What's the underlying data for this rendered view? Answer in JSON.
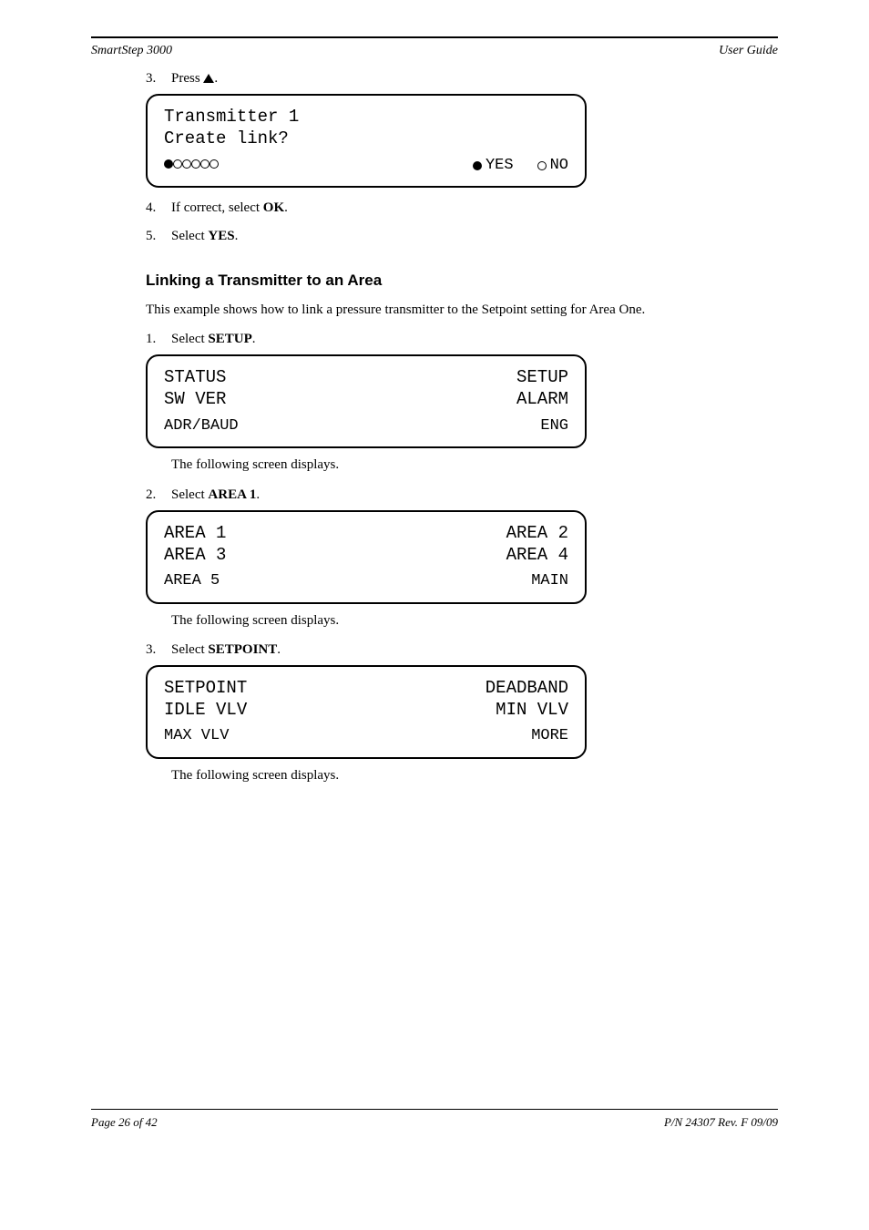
{
  "header": {
    "left": "SmartStep 3000",
    "right": "User Guide"
  },
  "steps": {
    "s3": {
      "num": "3.",
      "text_before": "Press ",
      "text_after": "."
    },
    "s4": {
      "num": "4.",
      "text_before": "If correct, select ",
      "label": "OK",
      "text_after": "."
    },
    "s5": {
      "num": "5.",
      "text_before": "Select ",
      "label": "YES",
      "text_after": "."
    }
  },
  "triangle_note": "▲",
  "section2": {
    "heading": "Linking a Transmitter to an Area",
    "body": "This example shows how to link a pressure transmitter to the Setpoint setting for Area One.",
    "step1": {
      "num": "1.",
      "text_before": "Select ",
      "label": "SETUP",
      "text_after": "."
    }
  },
  "section3": {
    "step2": {
      "num": "2.",
      "text_before": "Select ",
      "label": "AREA 1",
      "text_after": "."
    }
  },
  "section4": {
    "step3": {
      "num": "3.",
      "text_before": "Select ",
      "label": "SETPOINT",
      "text_after": "."
    }
  },
  "lcd1": {
    "line1_left": "Transmitter 1",
    "line1_right": "",
    "line2_left": "Create link?",
    "line2_right": "",
    "filled_label": "YES",
    "open_label": "NO"
  },
  "lcd2": {
    "line1_left": "STATUS",
    "line1_right": "SETUP",
    "line2_left": "SW VER",
    "line2_right": "ALARM",
    "bl": "ADR/BAUD",
    "br": "ENG"
  },
  "lcd3": {
    "line1_left": "AREA 1",
    "line1_right": "AREA 2",
    "line2_left": "AREA 3",
    "line2_right": "AREA 4",
    "bl": "AREA 5",
    "br": "MAIN"
  },
  "lcd4": {
    "line1_left": "SETPOINT",
    "line1_right": "DEADBAND",
    "line2_left": "IDLE VLV",
    "line2_right": "MIN VLV",
    "bl": "MAX VLV",
    "br": "MORE"
  },
  "followups": {
    "f1": "The following screen displays.",
    "f2": "The following screen displays.",
    "f3": "The following screen displays."
  },
  "footer": {
    "left": "Page 26 of 42",
    "right": "P/N 24307 Rev. F 09/09"
  }
}
